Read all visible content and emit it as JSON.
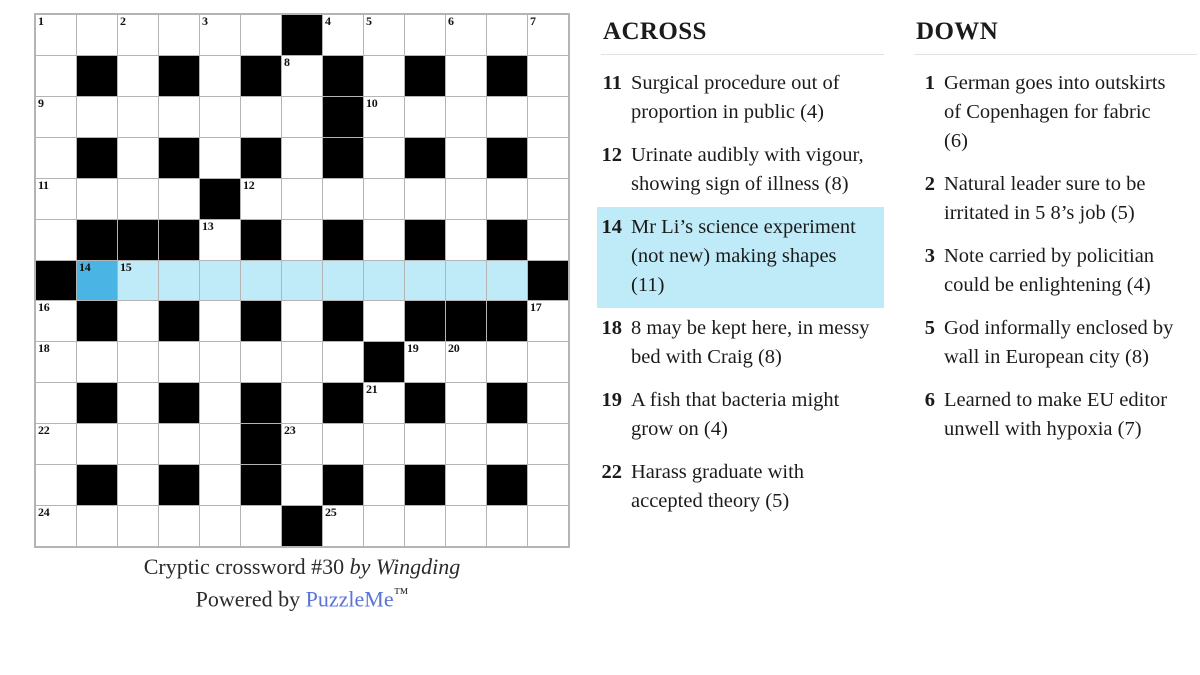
{
  "puzzle": {
    "caption_title": "Cryptic crossword #30",
    "caption_byline": "by Wingding",
    "caption_powered_prefix": "Powered by ",
    "caption_brand": "PuzzleMe",
    "caption_tm": "™",
    "grid": {
      "rows": 13,
      "cols": 13,
      "black_cells": [
        [
          0,
          6
        ],
        [
          1,
          1
        ],
        [
          1,
          3
        ],
        [
          1,
          5
        ],
        [
          1,
          7
        ],
        [
          1,
          9
        ],
        [
          1,
          11
        ],
        [
          2,
          7
        ],
        [
          3,
          1
        ],
        [
          3,
          3
        ],
        [
          3,
          5
        ],
        [
          3,
          7
        ],
        [
          3,
          9
        ],
        [
          3,
          11
        ],
        [
          4,
          4
        ],
        [
          5,
          1
        ],
        [
          5,
          2
        ],
        [
          5,
          3
        ],
        [
          5,
          5
        ],
        [
          5,
          7
        ],
        [
          5,
          9
        ],
        [
          5,
          11
        ],
        [
          6,
          0
        ],
        [
          6,
          12
        ],
        [
          7,
          1
        ],
        [
          7,
          3
        ],
        [
          7,
          5
        ],
        [
          7,
          7
        ],
        [
          7,
          9
        ],
        [
          7,
          10
        ],
        [
          7,
          11
        ],
        [
          8,
          8
        ],
        [
          9,
          1
        ],
        [
          9,
          3
        ],
        [
          9,
          5
        ],
        [
          9,
          7
        ],
        [
          9,
          9
        ],
        [
          9,
          11
        ],
        [
          10,
          5
        ],
        [
          11,
          1
        ],
        [
          11,
          3
        ],
        [
          11,
          5
        ],
        [
          11,
          7
        ],
        [
          11,
          9
        ],
        [
          11,
          11
        ],
        [
          12,
          6
        ]
      ],
      "highlight_cells": [
        [
          6,
          1
        ],
        [
          6,
          2
        ],
        [
          6,
          3
        ],
        [
          6,
          4
        ],
        [
          6,
          5
        ],
        [
          6,
          6
        ],
        [
          6,
          7
        ],
        [
          6,
          8
        ],
        [
          6,
          9
        ],
        [
          6,
          10
        ],
        [
          6,
          11
        ]
      ],
      "cursor_cell": [
        6,
        1
      ],
      "numbers": [
        {
          "row": 0,
          "col": 0,
          "n": "1"
        },
        {
          "row": 0,
          "col": 2,
          "n": "2"
        },
        {
          "row": 0,
          "col": 4,
          "n": "3"
        },
        {
          "row": 0,
          "col": 7,
          "n": "4"
        },
        {
          "row": 0,
          "col": 8,
          "n": "5"
        },
        {
          "row": 0,
          "col": 10,
          "n": "6"
        },
        {
          "row": 0,
          "col": 12,
          "n": "7"
        },
        {
          "row": 1,
          "col": 6,
          "n": "8"
        },
        {
          "row": 2,
          "col": 0,
          "n": "9"
        },
        {
          "row": 2,
          "col": 8,
          "n": "10"
        },
        {
          "row": 4,
          "col": 0,
          "n": "11"
        },
        {
          "row": 4,
          "col": 5,
          "n": "12"
        },
        {
          "row": 5,
          "col": 4,
          "n": "13"
        },
        {
          "row": 6,
          "col": 1,
          "n": "14"
        },
        {
          "row": 6,
          "col": 2,
          "n": "15"
        },
        {
          "row": 7,
          "col": 0,
          "n": "16"
        },
        {
          "row": 7,
          "col": 12,
          "n": "17"
        },
        {
          "row": 8,
          "col": 0,
          "n": "18"
        },
        {
          "row": 8,
          "col": 9,
          "n": "19"
        },
        {
          "row": 8,
          "col": 10,
          "n": "20"
        },
        {
          "row": 9,
          "col": 8,
          "n": "21"
        },
        {
          "row": 10,
          "col": 0,
          "n": "22"
        },
        {
          "row": 10,
          "col": 6,
          "n": "23"
        },
        {
          "row": 12,
          "col": 0,
          "n": "24"
        },
        {
          "row": 12,
          "col": 7,
          "n": "25"
        }
      ]
    }
  },
  "clues": {
    "across": {
      "heading": "ACROSS",
      "items": [
        {
          "num": "11",
          "text": "Surgical procedure out of proportion in public (4)",
          "selected": false
        },
        {
          "num": "12",
          "text": "Urinate audibly with vigour, showing sign of illness (8)",
          "selected": false
        },
        {
          "num": "14",
          "text": "Mr Li’s science experiment (not new) making shapes (11)",
          "selected": true
        },
        {
          "num": "18",
          "text": "8 may be kept here, in messy bed with Craig (8)",
          "selected": false
        },
        {
          "num": "19",
          "text": "A fish that bacteria might grow on (4)",
          "selected": false
        },
        {
          "num": "22",
          "text": "Harass graduate with accepted theory (5)",
          "selected": false
        }
      ]
    },
    "down": {
      "heading": "DOWN",
      "items": [
        {
          "num": "1",
          "text": "German goes into outskirts of Copenhagen for fabric (6)",
          "selected": false
        },
        {
          "num": "2",
          "text": "Natural leader sure to be irritated in 5 8’s job (5)",
          "selected": false
        },
        {
          "num": "3",
          "text": "Note carried by policitian could be enlightening (4)",
          "selected": false
        },
        {
          "num": "5",
          "text": "God informally enclosed by wall in European city (8)",
          "selected": false
        },
        {
          "num": "6",
          "text": "Learned to make EU editor unwell with hypoxia (7)",
          "selected": false
        }
      ]
    }
  },
  "colors": {
    "cursor_cell": "#4ab5e5",
    "highlight": "#bfeaf7",
    "brand_link": "#5b73d8",
    "grid_line": "#b4b4b4"
  }
}
